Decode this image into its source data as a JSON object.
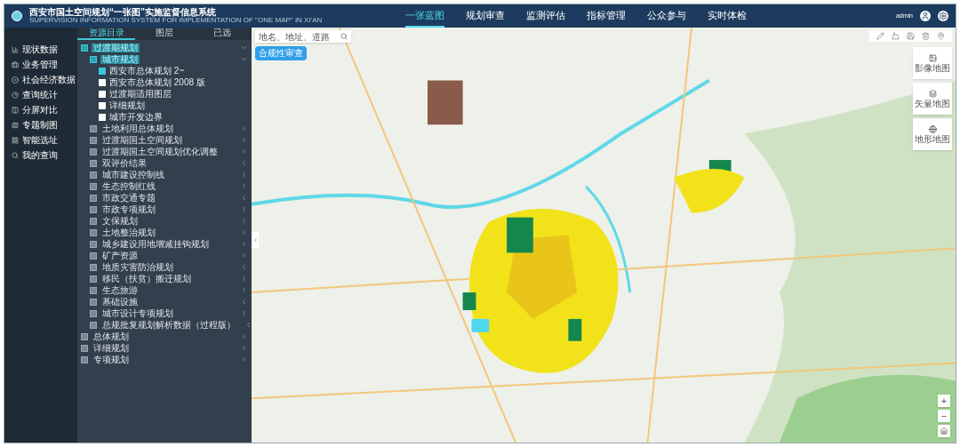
{
  "header": {
    "title": "西安市国土空间规划“一张图”实施监督信息系统",
    "subtitle": "SUPERVISION INFORMATION SYSTEM FOR IMPLEMENTATION OF \"ONE MAP\" IN XI'AN",
    "nav": [
      {
        "label": "一张蓝图",
        "selected": true
      },
      {
        "label": "规划审查",
        "selected": false
      },
      {
        "label": "监测评估",
        "selected": false
      },
      {
        "label": "指标管理",
        "selected": false
      },
      {
        "label": "公众参与",
        "selected": false
      },
      {
        "label": "实时体检",
        "selected": false
      }
    ],
    "user": "admin"
  },
  "menu": [
    {
      "label": "现状数据"
    },
    {
      "label": "业务管理"
    },
    {
      "label": "社会经济数据"
    },
    {
      "label": "查询统计"
    },
    {
      "label": "分屏对比"
    },
    {
      "label": "专题制图"
    },
    {
      "label": "智能选址"
    },
    {
      "label": "我的查询"
    }
  ],
  "panel_tabs": [
    {
      "label": "资源目录",
      "selected": true
    },
    {
      "label": "图层",
      "selected": false
    },
    {
      "label": "已选",
      "selected": false
    }
  ],
  "tree": [
    {
      "kind": "folder",
      "label": "过渡期规划",
      "expanded": true,
      "children": [
        {
          "kind": "folder",
          "label": "城市规划",
          "expanded": true,
          "children": [
            {
              "kind": "layer",
              "label": "西安市总体规划 2~",
              "checked": true
            },
            {
              "kind": "layer",
              "label": "西安市总体规划 2008 版",
              "checked": false
            },
            {
              "kind": "layer",
              "label": "过渡期适用图层",
              "checked": false
            },
            {
              "kind": "layer",
              "label": "详细规划",
              "checked": false
            },
            {
              "kind": "layer",
              "label": "城市开发边界",
              "checked": false
            }
          ]
        },
        {
          "kind": "folder",
          "label": "土地利用总体规划",
          "expanded": false
        },
        {
          "kind": "folder",
          "label": "过渡期国土空间规划",
          "expanded": false
        },
        {
          "kind": "folder",
          "label": "过渡期国土空间规划优化调整",
          "expanded": false
        },
        {
          "kind": "folder",
          "label": "双评价结果",
          "expanded": false
        },
        {
          "kind": "folder",
          "label": "城市建设控制线",
          "expanded": false
        },
        {
          "kind": "folder",
          "label": "生态控制红线",
          "expanded": false
        },
        {
          "kind": "folder",
          "label": "市政交通专题",
          "expanded": false
        },
        {
          "kind": "folder",
          "label": "市政专项规划",
          "expanded": false
        },
        {
          "kind": "folder",
          "label": "文保规划",
          "expanded": false
        },
        {
          "kind": "folder",
          "label": "土地整治规划",
          "expanded": false
        },
        {
          "kind": "folder",
          "label": "城乡建设用地增减挂钩规划",
          "expanded": false
        },
        {
          "kind": "folder",
          "label": "矿产资源",
          "expanded": false
        },
        {
          "kind": "folder",
          "label": "地质灾害防治规划",
          "expanded": false
        },
        {
          "kind": "folder",
          "label": "移民（扶贫）搬迁规划",
          "expanded": false
        },
        {
          "kind": "folder",
          "label": "生态旅游",
          "expanded": false
        },
        {
          "kind": "folder",
          "label": "基础设施",
          "expanded": false
        },
        {
          "kind": "folder",
          "label": "城市设计专项规划",
          "expanded": false
        },
        {
          "kind": "folder",
          "label": "总规批复规划解析数据（过程版）",
          "expanded": false
        }
      ]
    },
    {
      "kind": "folder",
      "label": "总体规划",
      "expanded": false
    },
    {
      "kind": "folder",
      "label": "详细规划",
      "expanded": false
    },
    {
      "kind": "folder",
      "label": "专项规划",
      "expanded": false
    }
  ],
  "map": {
    "search": {
      "placeholder": "地名、地址、道路"
    },
    "review_button": "合规性审查",
    "basemaps": [
      {
        "label": "影像地图"
      },
      {
        "label": "矢量地图"
      },
      {
        "label": "地形地图"
      }
    ],
    "zoom_in": "+",
    "zoom_out": "−"
  }
}
